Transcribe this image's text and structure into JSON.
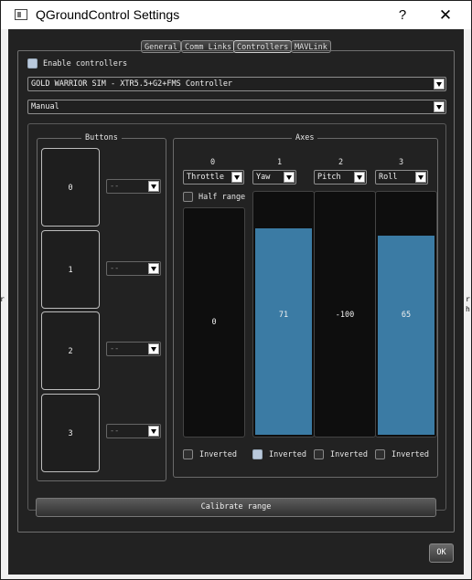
{
  "window": {
    "title": "QGroundControl Settings",
    "help": "?",
    "close": "✕"
  },
  "tabs": [
    "General",
    "Comm Links",
    "Controllers",
    "MAVLink"
  ],
  "enable_controllers_label": "Enable controllers",
  "controller_select": "GOLD WARRIOR SIM -  XTR5.5+G2+FMS Controller",
  "mode_select": "Manual",
  "buttons_group": {
    "title": "Buttons",
    "buttons": [
      {
        "label": "0",
        "action": "--"
      },
      {
        "label": "1",
        "action": "--"
      },
      {
        "label": "2",
        "action": "--"
      },
      {
        "label": "3",
        "action": "--"
      }
    ]
  },
  "axes_group": {
    "title": "Axes",
    "half_range_label": "Half range",
    "inverted_label": "Inverted",
    "axes": [
      {
        "index": "0",
        "mapping": "Throttle",
        "value": "0",
        "fill_fraction": 0.0,
        "inverted": false
      },
      {
        "index": "1",
        "mapping": "Yaw",
        "value": "71",
        "fill_fraction": 0.855,
        "inverted": true
      },
      {
        "index": "2",
        "mapping": "Pitch",
        "value": "-100",
        "fill_fraction": 0.0,
        "inverted": false
      },
      {
        "index": "3",
        "mapping": "Roll",
        "value": "65",
        "fill_fraction": 0.825,
        "inverted": false
      }
    ]
  },
  "calibrate_label": "Calibrate range",
  "ok_label": "OK",
  "background_edge_text": {
    "left": "r",
    "right_top": "r",
    "right_bottom": "h"
  },
  "colors": {
    "axis_fill": "#3b7ba4",
    "panel": "#222222"
  }
}
